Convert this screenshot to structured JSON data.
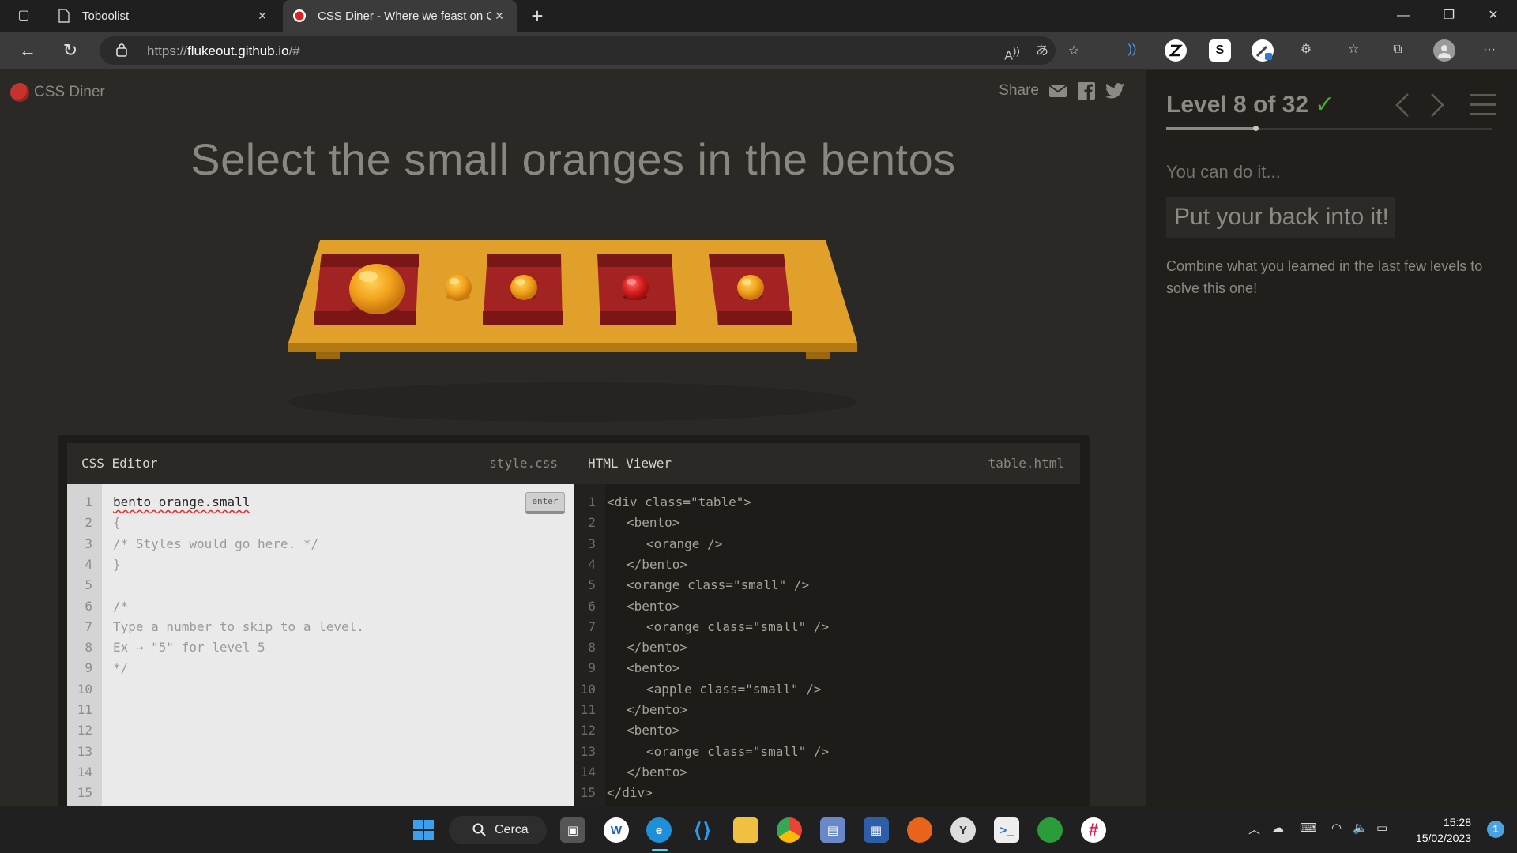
{
  "browser": {
    "tabs": [
      {
        "title": "Toboolist",
        "icon": "page-icon"
      },
      {
        "title": "CSS Diner - Where we feast on C",
        "icon": "css-diner-favicon"
      }
    ],
    "url_prefix": "https://",
    "url_host": "flukeout.github.io",
    "url_path": "/#",
    "ext_labels": [
      "S"
    ]
  },
  "page": {
    "logo_text": "CSS Diner",
    "share_label": "Share",
    "instruction": "Select the small oranges in the bentos"
  },
  "editor": {
    "css_title": "CSS Editor",
    "css_file": "style.css",
    "html_title": "HTML Viewer",
    "html_file": "table.html",
    "enter_label": "enter",
    "css_lines": [
      "bento orange.small",
      "{",
      "/* Styles would go here. */",
      "}",
      "",
      "/*",
      "Type a number to skip to a level.",
      "Ex → \"5\" for level 5",
      "*/",
      "",
      "",
      "",
      "",
      "",
      ""
    ],
    "html_lines": [
      {
        "indent": 0,
        "text": "<div class=\"table\">"
      },
      {
        "indent": 1,
        "text": "<bento>"
      },
      {
        "indent": 2,
        "text": "<orange />"
      },
      {
        "indent": 1,
        "text": "</bento>"
      },
      {
        "indent": 1,
        "text": "<orange class=\"small\" />"
      },
      {
        "indent": 1,
        "text": "<bento>"
      },
      {
        "indent": 2,
        "text": "<orange class=\"small\" />"
      },
      {
        "indent": 1,
        "text": "</bento>"
      },
      {
        "indent": 1,
        "text": "<bento>"
      },
      {
        "indent": 2,
        "text": "<apple class=\"small\" />"
      },
      {
        "indent": 1,
        "text": "</bento>"
      },
      {
        "indent": 1,
        "text": "<bento>"
      },
      {
        "indent": 2,
        "text": "<orange class=\"small\" />"
      },
      {
        "indent": 1,
        "text": "</bento>"
      },
      {
        "indent": 0,
        "text": "</div>"
      }
    ]
  },
  "sidebar": {
    "level_label": "Level 8 of 32",
    "level_current": 8,
    "level_total": 32,
    "completed_check": "✓",
    "subtitle": "You can do it...",
    "callout": "Put your back into it!",
    "description": "Combine what you learned in the last few levels to solve this one!"
  },
  "taskbar": {
    "search_label": "Cerca",
    "time": "15:28",
    "date": "15/02/2023",
    "notifications": "1"
  },
  "colors": {
    "accent_check": "#4aa83a",
    "orange": "#f2a11b",
    "apple": "#d71f1f",
    "table": "#e0a02a"
  }
}
